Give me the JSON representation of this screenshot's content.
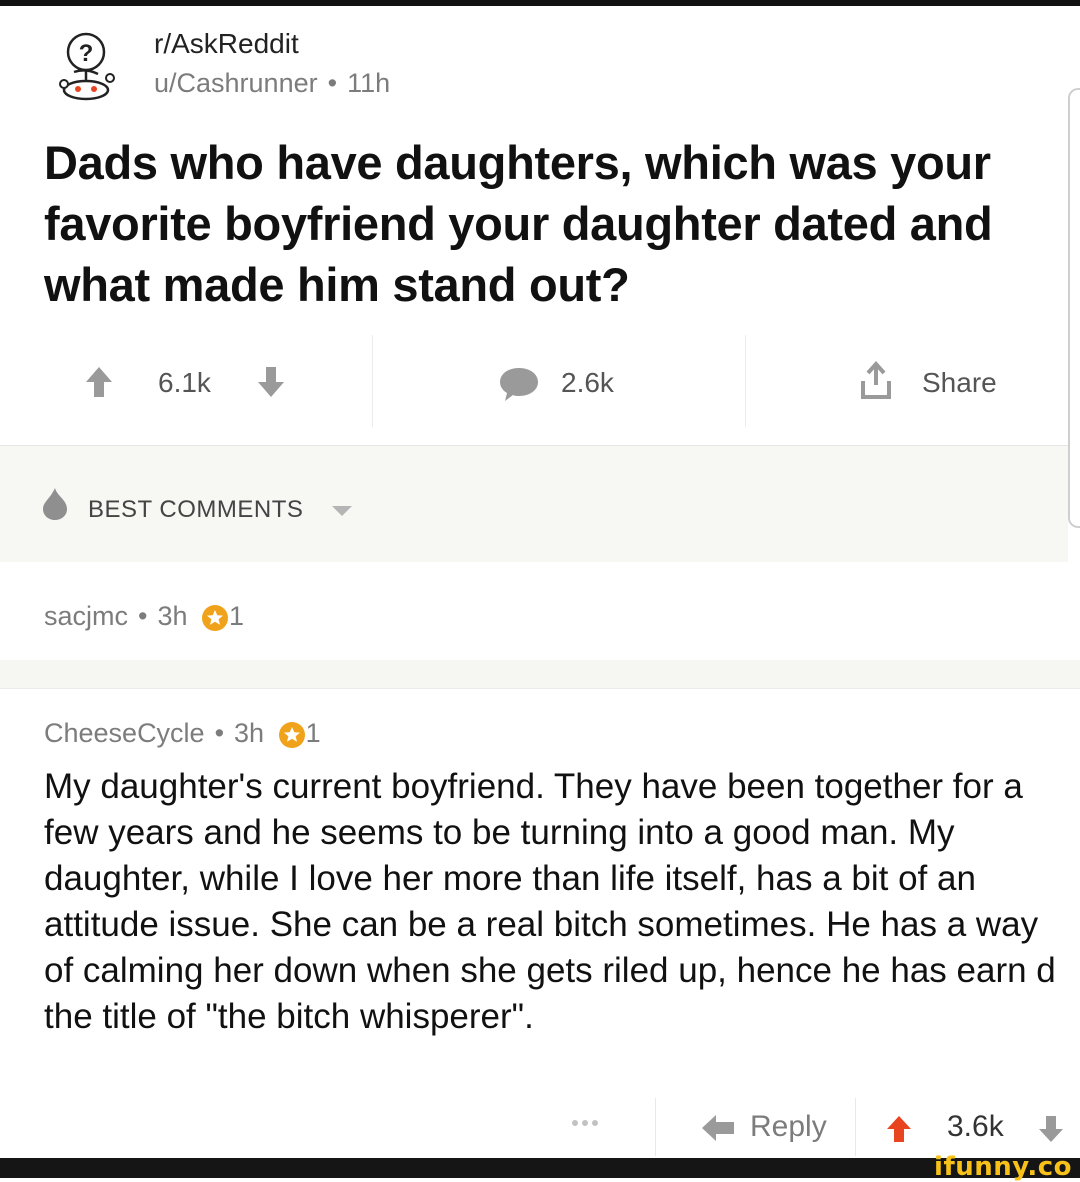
{
  "post": {
    "subreddit": "r/AskReddit",
    "author": "u/Cashrunner",
    "age": "11h",
    "separator": "•",
    "title": "Dads who have daughters, which was your favorite boyfriend your daughter dated and what made him stand out?"
  },
  "actions": {
    "upvotes": "6.1k",
    "comments": "2.6k",
    "share_label": "Share"
  },
  "sort": {
    "label": "BEST COMMENTS"
  },
  "comments": [
    {
      "author": "sacjmc",
      "age": "3h",
      "awards": "1"
    },
    {
      "author": "CheeseCycle",
      "age": "3h",
      "awards": "1",
      "body": "My daughter's current boyfriend. They have been together for a few years and he seems to be turning into a good man.  My daughter, while I love her more than life itself, has a bit of an attitude issue. She can be a real bitch sometimes.  He has a way of calming her down when she gets riled up, hence he has earn d the title of \"the bitch whisperer\".",
      "reply_label": "Reply",
      "score": "3.6k"
    }
  ],
  "watermark": "ifunny.co",
  "colors": {
    "upvote_active": "#e8441f",
    "muted_icon": "#9a9a9a",
    "award": "#f0a31a",
    "strip_bg": "#f7f7f4"
  }
}
